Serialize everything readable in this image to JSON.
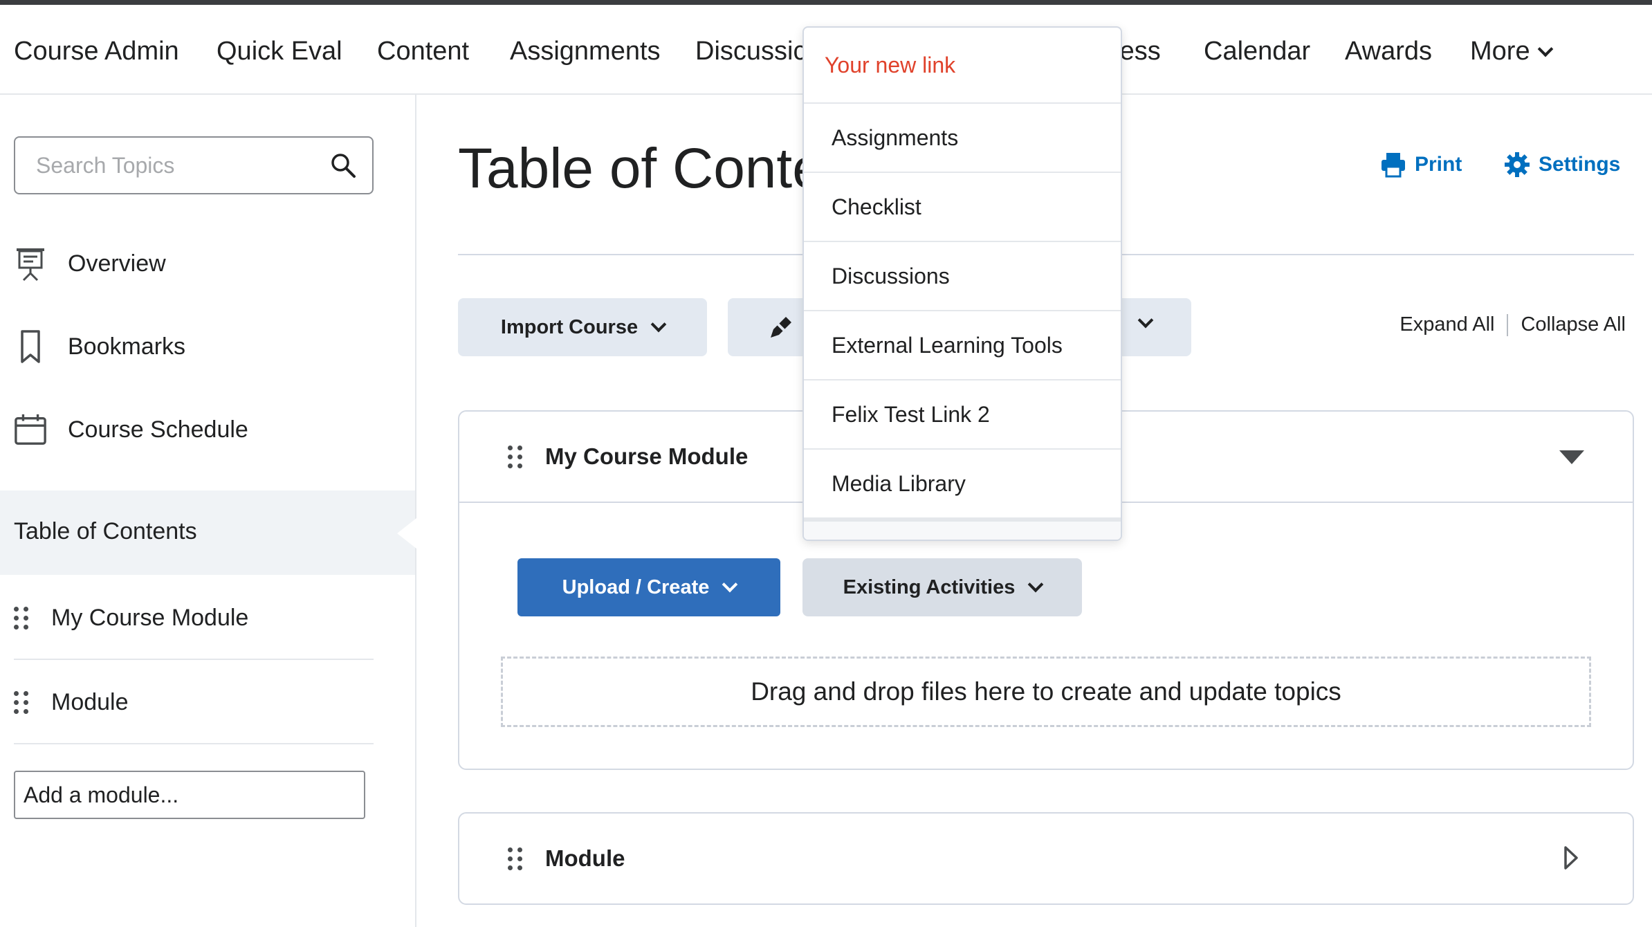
{
  "nav": {
    "items": [
      "Course Admin",
      "Quick Eval",
      "Content",
      "Assignments",
      "Discussic",
      "ress",
      "Calendar",
      "Awards"
    ],
    "more_label": "More"
  },
  "sidebar": {
    "search_placeholder": "Search Topics",
    "links": [
      {
        "label": "Overview",
        "icon": "presentation-icon"
      },
      {
        "label": "Bookmarks",
        "icon": "bookmark-icon"
      },
      {
        "label": "Course Schedule",
        "icon": "calendar-icon"
      }
    ],
    "toc_label": "Table of Contents",
    "modules": [
      "My Course Module",
      "Module"
    ],
    "add_module": "Add a module..."
  },
  "main": {
    "title": "Table of Conte",
    "print_label": "Print",
    "settings_label": "Settings",
    "import_course_label": "Import Course",
    "expand_all": "Expand All",
    "collapse_all": "Collapse All",
    "modules": [
      {
        "name": "My Course Module",
        "expanded": true,
        "upload_label": "Upload / Create",
        "existing_label": "Existing Activities",
        "dropzone_text": "Drag and drop files here to create and update topics"
      },
      {
        "name": "Module",
        "expanded": false
      }
    ]
  },
  "menu": {
    "items": [
      "Your new link",
      "Assignments",
      "Checklist",
      "Discussions",
      "External Learning Tools",
      "Felix Test Link 2",
      "Media Library"
    ]
  },
  "colors": {
    "accent_blue": "#006fbf",
    "primary_button": "#2f6ebb",
    "highlight_link": "#e0422b"
  }
}
